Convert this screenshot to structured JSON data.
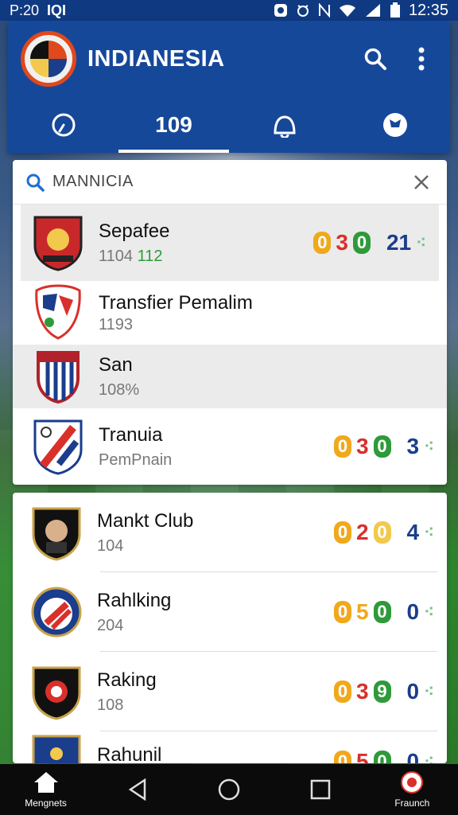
{
  "status_bar": {
    "left_text": "P:20",
    "left_icon_text": "IQI",
    "time": "12:35",
    "icons": [
      "notification-icon",
      "alarm-icon",
      "nfc-icon",
      "wifi-icon",
      "signal-icon",
      "battery-icon"
    ]
  },
  "header": {
    "title": "INDIANESIA",
    "tabs": [
      {
        "icon": "clock-icon",
        "label": ""
      },
      {
        "icon": "",
        "label": "109"
      },
      {
        "icon": "bell-icon",
        "label": ""
      },
      {
        "icon": "ball-icon",
        "label": ""
      }
    ],
    "active_tab": 1
  },
  "search": {
    "query": "MANNICIA"
  },
  "results": [
    {
      "name": "Sepafee",
      "sub_grey": "1104",
      "sub_green": "112",
      "scores": [
        "0",
        "3",
        "0"
      ],
      "rank": "21",
      "highlight": true
    },
    {
      "name": "Transfier Pemalim",
      "sub_grey": "1193",
      "sub_green": "",
      "scores": [],
      "rank": "",
      "highlight": false
    },
    {
      "name": "San",
      "sub_grey": "108%",
      "sub_green": "",
      "scores": [],
      "rank": "",
      "highlight": true
    },
    {
      "name": "Tranuia",
      "sub_grey": "PemPnain",
      "sub_green": "",
      "scores": [
        "0",
        "3",
        "0"
      ],
      "rank": "3",
      "highlight": false
    }
  ],
  "list": [
    {
      "name": "Mankt Club",
      "sub": "104",
      "scores": [
        "0",
        "2",
        "0"
      ],
      "rank": "4"
    },
    {
      "name": "Rahlking",
      "sub": "204",
      "scores": [
        "0",
        "5",
        "0"
      ],
      "rank": "0"
    },
    {
      "name": "Raking",
      "sub": "108",
      "scores": [
        "0",
        "3",
        "9"
      ],
      "rank": "0"
    },
    {
      "name": "Rahunil",
      "sub": "",
      "scores": [
        "0",
        "5",
        "0"
      ],
      "rank": "0"
    }
  ],
  "nav": {
    "home_label": "Mengnets",
    "profile_label": "Fraunch"
  },
  "colors": {
    "primary": "#16489a",
    "status_bar": "#0f3a82",
    "score_orange": "#f0a81c",
    "score_red": "#d9302a",
    "score_green": "#2e9a3a",
    "rank_blue": "#1a3d8c"
  }
}
